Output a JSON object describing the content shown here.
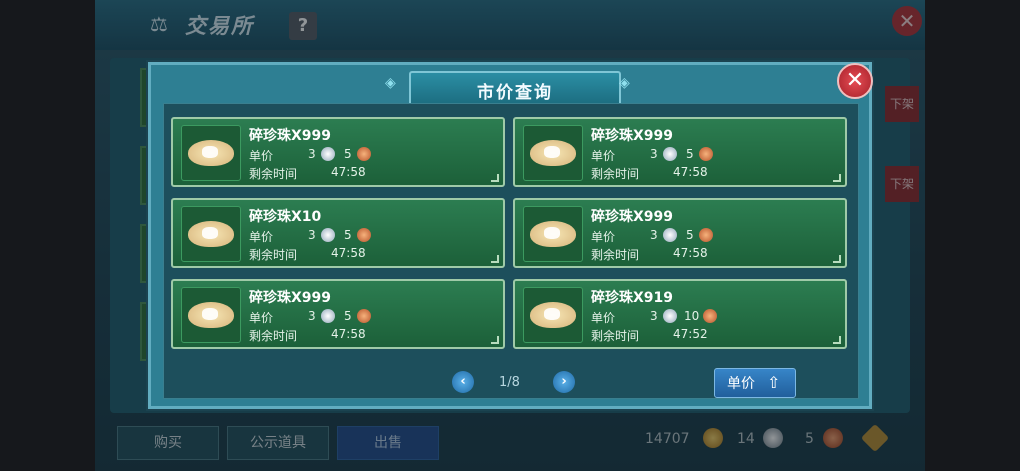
{
  "window": {
    "title": "交易所",
    "help_label": "?",
    "close_label": "✕"
  },
  "background": {
    "side_buttons": [
      "下架",
      "下架"
    ],
    "tabs": [
      {
        "label": "购买",
        "active": false
      },
      {
        "label": "公示道具",
        "active": false
      },
      {
        "label": "出售",
        "active": true
      }
    ],
    "currencies": [
      {
        "amount": "14707",
        "icon": "gold-coin-icon",
        "color": "#c9952f"
      },
      {
        "amount": "14",
        "icon": "silver-coin-icon",
        "color": "#8e9aa3"
      },
      {
        "amount": "5",
        "icon": "copper-coin-icon",
        "color": "#b4532f"
      }
    ]
  },
  "dialog": {
    "title": "市价查询",
    "close_label": "✕",
    "price_label": "单价",
    "time_label": "剩余时间",
    "listings": [
      {
        "name": "碎珍珠X999",
        "silver": "3",
        "copper": "5",
        "time": "47:58"
      },
      {
        "name": "碎珍珠X999",
        "silver": "3",
        "copper": "5",
        "time": "47:58"
      },
      {
        "name": "碎珍珠X10",
        "silver": "3",
        "copper": "5",
        "time": "47:58"
      },
      {
        "name": "碎珍珠X999",
        "silver": "3",
        "copper": "5",
        "time": "47:58"
      },
      {
        "name": "碎珍珠X999",
        "silver": "3",
        "copper": "5",
        "time": "47:58"
      },
      {
        "name": "碎珍珠X919",
        "silver": "3",
        "copper": "10",
        "time": "47:52"
      }
    ],
    "pagination": {
      "page": "1/8",
      "prev": "‹",
      "next": "›"
    },
    "sort_button": {
      "label": "单价"
    }
  }
}
